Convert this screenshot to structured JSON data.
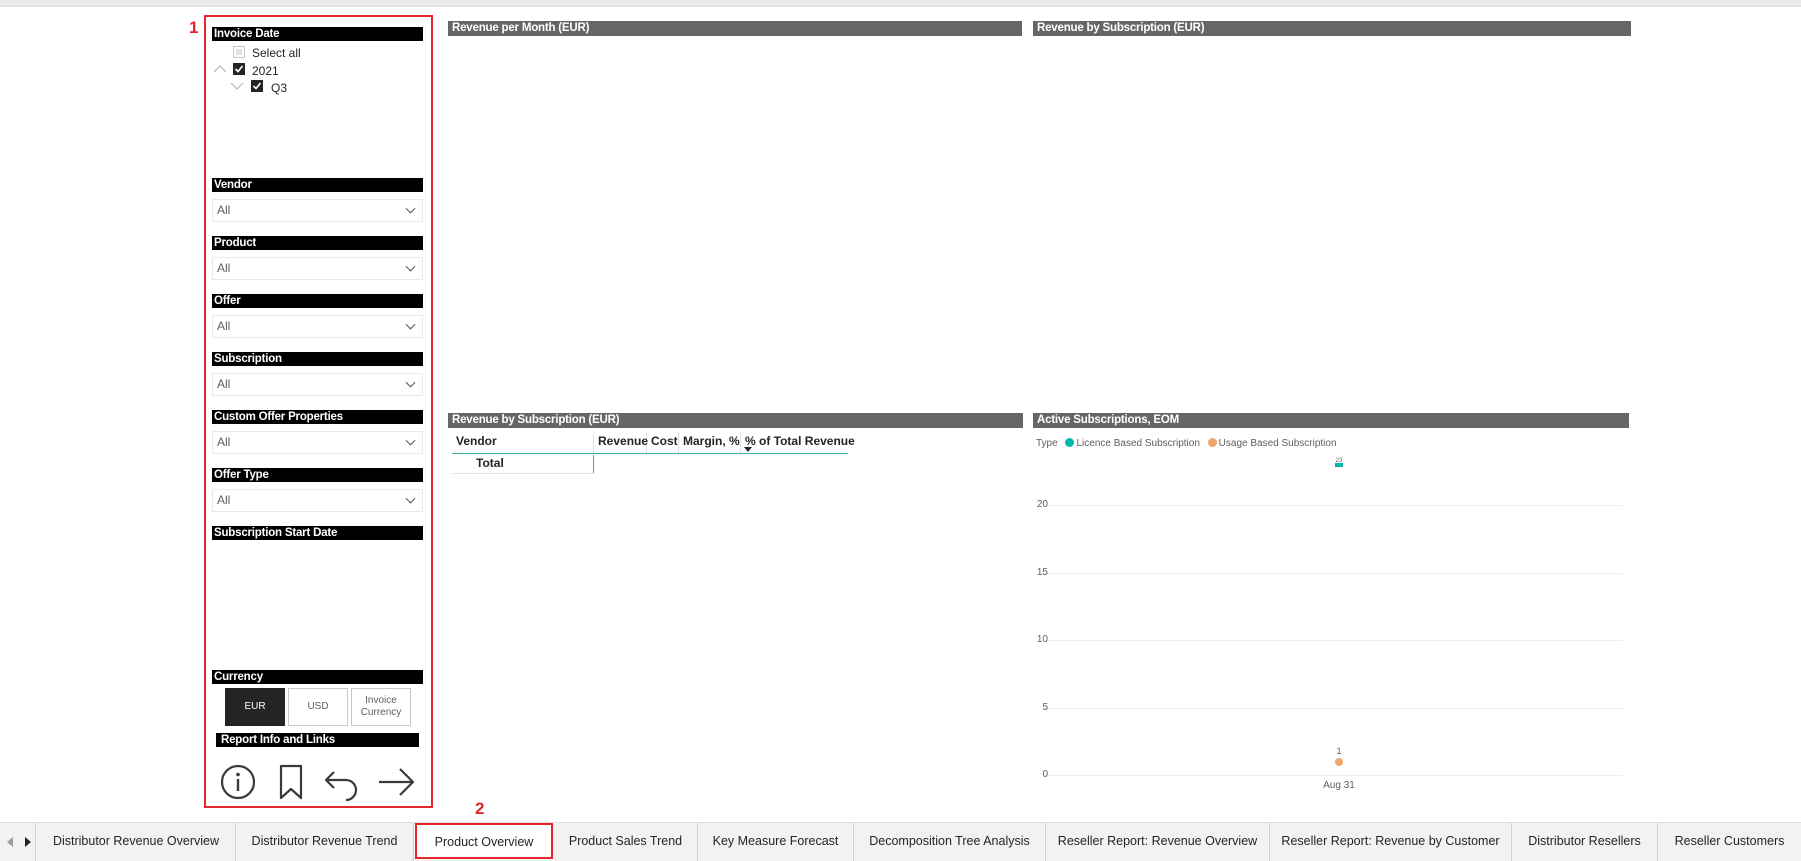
{
  "callouts": {
    "one": "1",
    "two": "2"
  },
  "invoice_date": {
    "header": "Invoice Date",
    "select_all": "Select all",
    "year": "2021",
    "quarter": "Q3"
  },
  "filters": [
    {
      "header": "Vendor",
      "value": "All"
    },
    {
      "header": "Product",
      "value": "All"
    },
    {
      "header": "Offer",
      "value": "All"
    },
    {
      "header": "Subscription",
      "value": "All"
    },
    {
      "header": "Custom Offer Properties",
      "value": "All"
    },
    {
      "header": "Offer Type",
      "value": "All"
    }
  ],
  "subscription_start_date": {
    "header": "Subscription Start Date"
  },
  "currency": {
    "header": "Currency",
    "options": [
      "EUR",
      "USD",
      "Invoice Currency"
    ],
    "selected": "EUR"
  },
  "report_info": {
    "header": "Report Info and Links",
    "icons": [
      "info-icon",
      "bookmark-icon",
      "back-icon",
      "forward-icon"
    ]
  },
  "visuals": {
    "revenue_per_month": "Revenue per Month (EUR)",
    "revenue_by_subscription_top": "Revenue by Subscription (EUR)",
    "revenue_by_subscription_table": "Revenue by Subscription (EUR)",
    "active_subscriptions": "Active Subscriptions, EOM"
  },
  "table": {
    "columns": [
      "Vendor",
      "Revenue",
      "Cost",
      "Margin, %",
      "% of Total Revenue"
    ],
    "total_label": "Total"
  },
  "active_chart_legend": {
    "label": "Type",
    "items": [
      {
        "name": "Licence Based Subscription",
        "color": "#01b8aa"
      },
      {
        "name": "Usage Based Subscription",
        "color": "#f2a46f"
      }
    ]
  },
  "chart_data": {
    "type": "line",
    "title": "Active Subscriptions, EOM",
    "categories": [
      "Aug 31"
    ],
    "series": [
      {
        "name": "Licence Based Subscription",
        "values": [
          23
        ],
        "data_labels": [
          "23"
        ]
      },
      {
        "name": "Usage Based Subscription",
        "values": [
          1
        ],
        "data_labels": [
          "1"
        ]
      }
    ],
    "yticks": [
      "0",
      "5",
      "10",
      "15",
      "20"
    ],
    "ylim": [
      0,
      25
    ],
    "grid": true,
    "legend": "top-left"
  },
  "tabs": [
    "Distributor Revenue Overview",
    "Distributor Revenue Trend",
    "Product Overview",
    "Product Sales Trend",
    "Key Measure Forecast",
    "Decomposition Tree Analysis",
    "Reseller Report: Revenue Overview",
    "Reseller Report: Revenue by Customer",
    "Distributor Resellers",
    "Reseller Customers"
  ],
  "active_tab": "Product Overview",
  "colors": {
    "accent_red": "#e3262b",
    "header_gray": "#666666",
    "teal": "#01b8aa",
    "orange": "#f2a46f"
  }
}
